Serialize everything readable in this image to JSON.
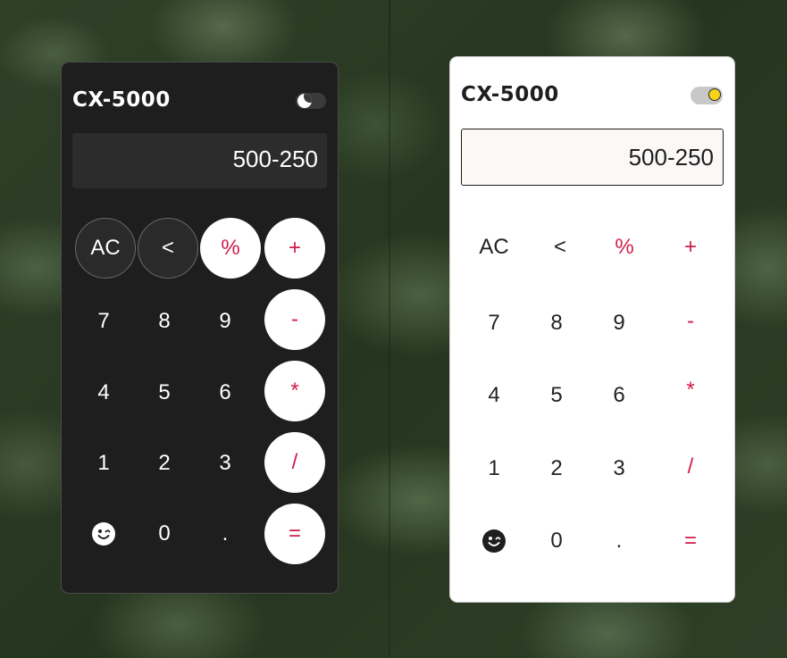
{
  "dark_calc": {
    "title": "CX-5000",
    "theme_toggle_icon": "moon-icon",
    "display": "500-250",
    "keys": [
      "AC",
      "<",
      "%",
      "+",
      "7",
      "8",
      "9",
      "-",
      "4",
      "5",
      "6",
      "*",
      "1",
      "2",
      "3",
      "/",
      "",
      "0",
      ".",
      "="
    ]
  },
  "light_calc": {
    "title": "CX-5000",
    "theme_toggle_icon": "sun-icon",
    "display": "500-250",
    "keys": [
      "AC",
      "<",
      "%",
      "+",
      "7",
      "8",
      "9",
      "-",
      "4",
      "5",
      "6",
      "*",
      "1",
      "2",
      "3",
      "/",
      "",
      "0",
      ".",
      "="
    ]
  },
  "colors": {
    "accent": "#d01c4a",
    "dark_bg": "#1e1e1e",
    "light_bg": "#ffffff",
    "sun": "#f6d31a"
  },
  "special_key_icon": "smiley-wink-icon"
}
